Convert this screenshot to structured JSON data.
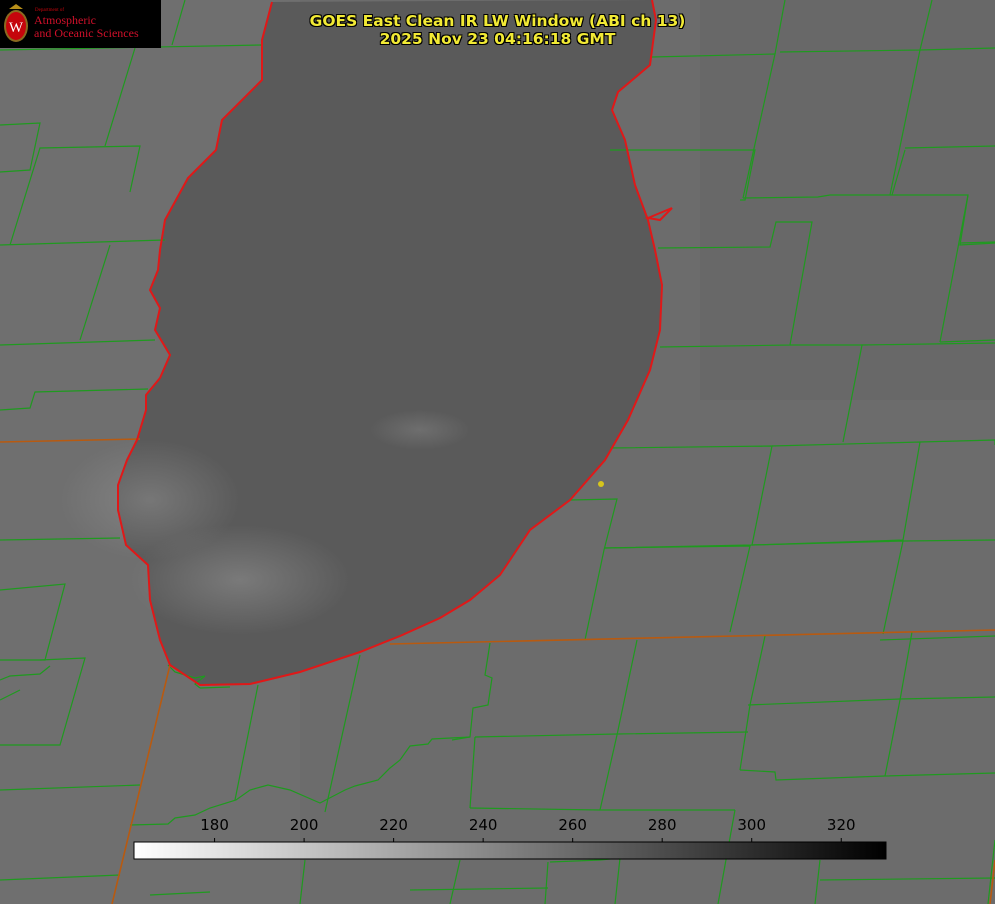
{
  "title": {
    "line1": "GOES East Clean IR LW Window (ABI ch 13)",
    "line2": "2025 Nov 23 04:16:18 GMT"
  },
  "logo": {
    "department": "Department of",
    "line1": "Atmospheric",
    "line2": "and Oceanic Sciences",
    "crest_letter": "W"
  },
  "colorbar": {
    "ticks": [
      180,
      200,
      220,
      240,
      260,
      280,
      300,
      320
    ],
    "min": 162,
    "max": 330,
    "gradient": "white-to-black"
  },
  "colors": {
    "title": "#f2ea35",
    "county_lines": "#1f9a1f",
    "state_lines": "#b85a10",
    "coastline": "#e01818",
    "station_marker": "#d6c51c"
  }
}
